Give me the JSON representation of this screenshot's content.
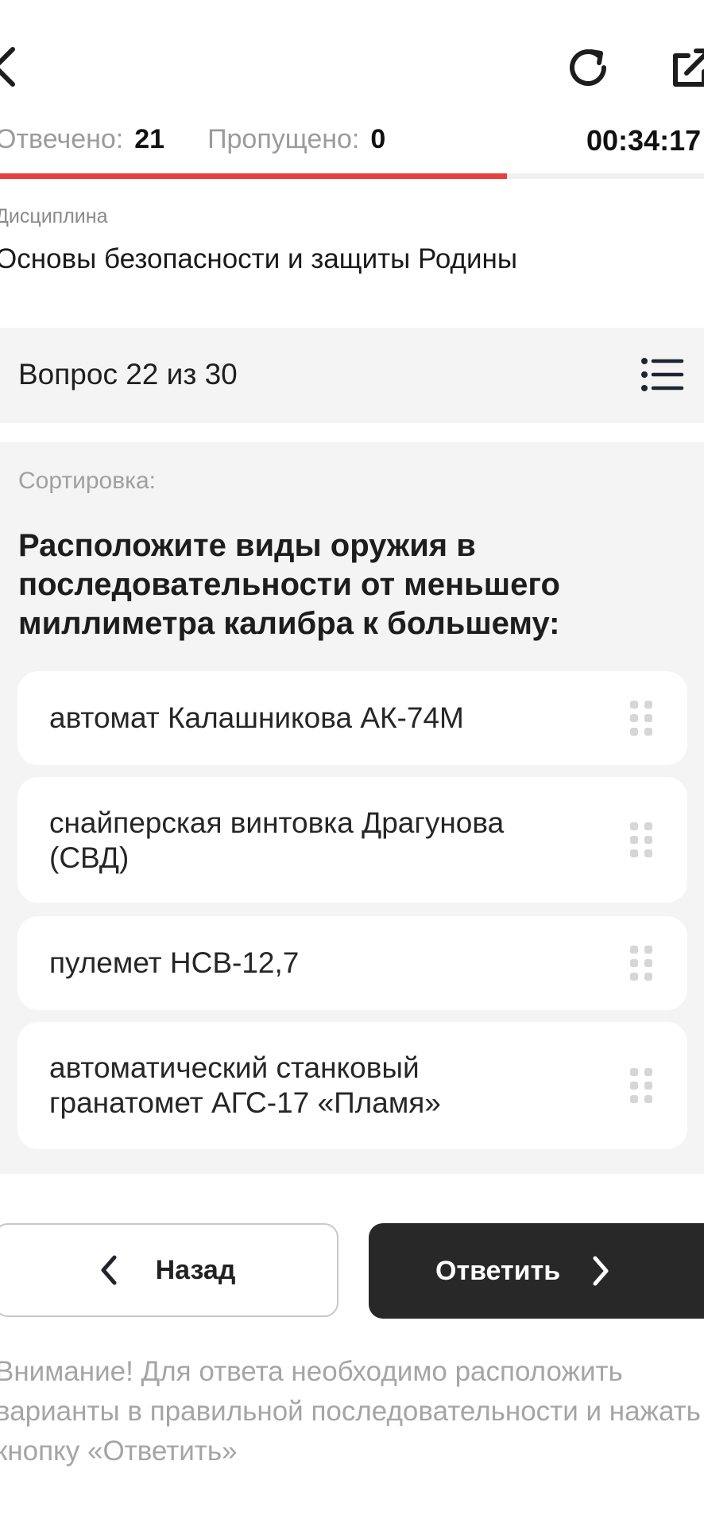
{
  "header": {
    "icons": [
      "back-icon",
      "reload-icon",
      "share-icon"
    ]
  },
  "stats": {
    "answered_label": "Отвечено:",
    "answered_value": "21",
    "skipped_label": "Пропущено:",
    "skipped_value": "0",
    "timer": "00:34:17",
    "progress_fraction": 0.72,
    "progress_color": "#e8403e"
  },
  "discipline": {
    "label": "Дисциплина",
    "title": "Основы безопасности и защиты Родины"
  },
  "question": {
    "header": "Вопрос 22 из 30",
    "type": "Сортировка:",
    "text": "Расположите виды оружия в последовательности от меньшего миллиметра калибра к большему:",
    "options": [
      "автомат Калашникова АК-74М",
      "снайперская винтовка Драгунова (СВД)",
      "пулемет НСВ-12,7",
      "автоматический станковый гранатомет АГС-17 «Пламя»"
    ]
  },
  "buttons": {
    "back": "Назад",
    "answer": "Ответить"
  },
  "notice": "Внимание! Для ответа необходимо расположить варианты в правильной последовательности и нажать кнопку «Ответить»"
}
